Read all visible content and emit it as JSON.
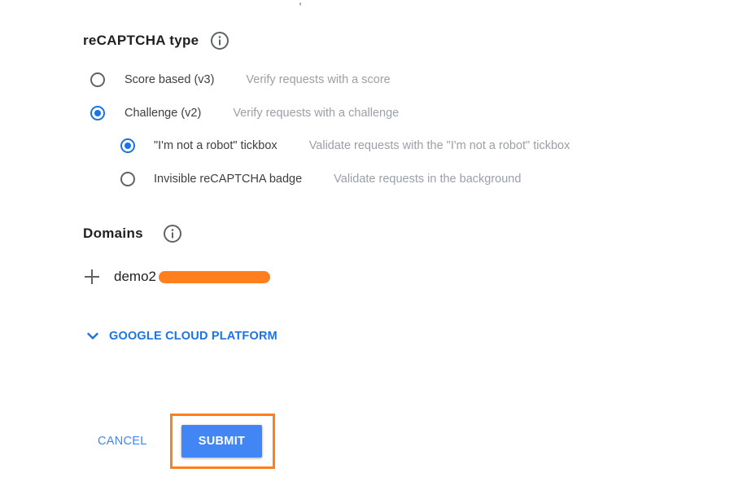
{
  "recaptcha_type": {
    "heading": "reCAPTCHA type",
    "options": [
      {
        "label": "Score based (v3)",
        "description": "Verify requests with a score",
        "selected": false
      },
      {
        "label": "Challenge (v2)",
        "description": "Verify requests with a challenge",
        "selected": true
      }
    ],
    "sub_options": [
      {
        "label": "\"I'm not a robot\" tickbox",
        "description": "Validate requests with the \"I'm not a robot\" tickbox",
        "selected": true
      },
      {
        "label": "Invisible reCAPTCHA badge",
        "description": "Validate requests in the background",
        "selected": false
      }
    ]
  },
  "domains": {
    "heading": "Domains",
    "items": [
      "demo2"
    ]
  },
  "gcp": {
    "label": "GOOGLE CLOUD PLATFORM"
  },
  "actions": {
    "cancel_label": "CANCEL",
    "submit_label": "SUBMIT"
  },
  "colors": {
    "accent": "#1a73e8",
    "button": "#4285f4",
    "highlight": "#ff7f1f",
    "muted_text": "#9aa0a6"
  },
  "icons": {
    "info": "info-icon",
    "add": "plus-icon",
    "expand": "chevron-down-icon"
  }
}
